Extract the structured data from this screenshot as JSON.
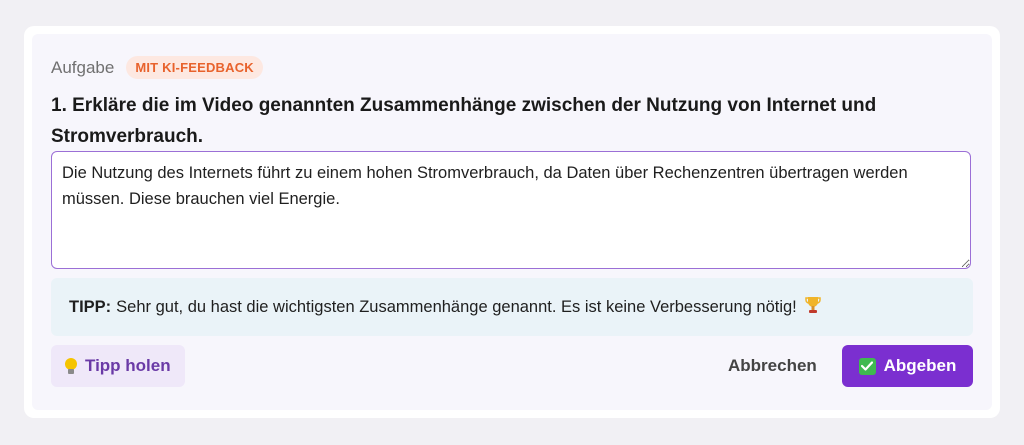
{
  "task": {
    "label": "Aufgabe",
    "badge": "MIT KI-FEEDBACK",
    "question": "1. Erkläre die im Video genannten Zusammenhänge zwischen der Nutzung von Internet und Stromverbrauch."
  },
  "answer": {
    "value": "Die Nutzung des Internets führt zu einem hohen Stromverbrauch, da Daten über Rechenzentren übertragen werden müssen. Diese brauchen viel Energie."
  },
  "tip": {
    "prefix": "TIPP:",
    "text": "Sehr gut, du hast die wichtigsten Zusammenhänge genannt. Es ist keine Verbesserung nötig!",
    "icon": "trophy-icon"
  },
  "actions": {
    "get_tip_label": "Tipp holen",
    "get_tip_icon": "lightbulb-icon",
    "cancel_label": "Abbrechen",
    "submit_label": "Abgeben",
    "submit_icon": "checkmark-icon"
  },
  "colors": {
    "accent": "#7b2fd0",
    "badge_text": "#e8622c",
    "badge_bg": "#fde8e1",
    "tip_bg": "#eaf3f8",
    "check_green": "#3fb950"
  }
}
